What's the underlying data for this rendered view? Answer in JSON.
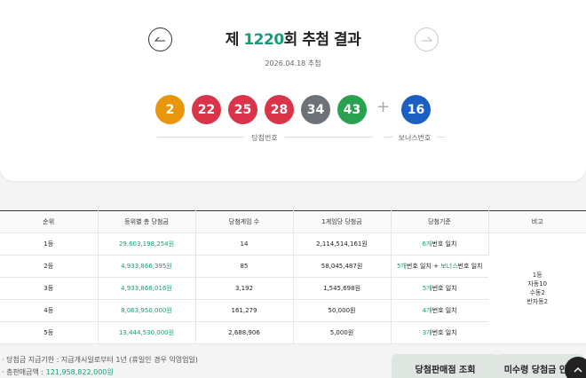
{
  "header": {
    "title_prefix": "제 ",
    "round": "1220",
    "title_suffix": "회 추첨 결과",
    "date": "2026.04.18 추첨",
    "prev_icon": "arrow-left-icon",
    "next_icon": "arrow-right-icon"
  },
  "balls": [
    {
      "number": "2",
      "color": "#e8960c"
    },
    {
      "number": "22",
      "color": "#d9344a"
    },
    {
      "number": "25",
      "color": "#d9344a"
    },
    {
      "number": "28",
      "color": "#d9344a"
    },
    {
      "number": "34",
      "color": "#6d7278"
    },
    {
      "number": "43",
      "color": "#2aa14f"
    }
  ],
  "bonus": {
    "number": "16",
    "color": "#1c5fc2"
  },
  "plus_sign": "+",
  "captions": {
    "winning": "당첨번호",
    "bonus": "보너스번호"
  },
  "table": {
    "headers": [
      "순위",
      "등위별 총 당첨금",
      "당첨게임 수",
      "1게임당 당첨금",
      "당첨기준",
      "비고"
    ],
    "rows": [
      {
        "rank": "1등",
        "total": "29,603,198,254원",
        "games": "14",
        "per_game": "2,114,514,161원",
        "crit_num": "6개",
        "crit_text": "번호 일치"
      },
      {
        "rank": "2등",
        "total": "4,933,866,395원",
        "games": "85",
        "per_game": "58,045,487원",
        "crit_num": "5개",
        "crit_text": "번호 일치 + ",
        "crit_bonus": "보너스",
        "crit_tail": "번호 일치"
      },
      {
        "rank": "3등",
        "total": "4,933,868,016원",
        "games": "3,192",
        "per_game": "1,545,698원",
        "crit_num": "5개",
        "crit_text": "번호 일치"
      },
      {
        "rank": "4등",
        "total": "8,063,950,000원",
        "games": "161,279",
        "per_game": "50,000원",
        "crit_num": "4개",
        "crit_text": "번호 일치"
      },
      {
        "rank": "5등",
        "total": "13,444,530,000원",
        "games": "2,688,906",
        "per_game": "5,000원",
        "crit_num": "3개",
        "crit_text": "번호 일치"
      }
    ],
    "remark_lines": [
      "1등",
      "자동10",
      "수동2",
      "반자동2"
    ]
  },
  "footer": {
    "deadline_label": "· 당첨금 지급기한 : 지급개시일로부터 1년 (휴일인 경우 익영업일)",
    "total_sales_label": "· 총판매금액 : ",
    "total_sales_value": "121,958,822,000원"
  },
  "buttons": {
    "shops": "당첨판매점 조회",
    "unclaimed": "미수령 당첨금 안내"
  }
}
